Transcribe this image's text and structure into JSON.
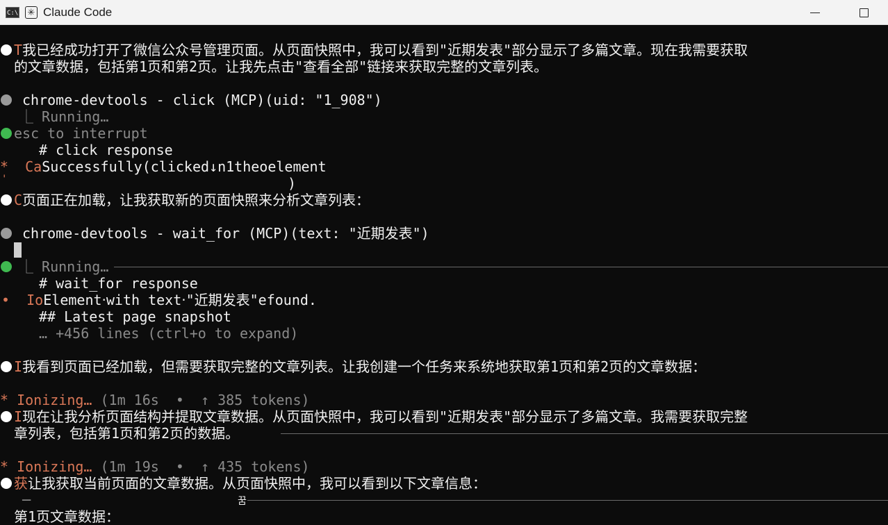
{
  "window": {
    "title": "Claude Code",
    "terminal_icon_text": "C:\\."
  },
  "lines": {
    "l1_prefix": "T",
    "l1": "我已经成功打开了微信公众号管理页面。从页面快照中，我可以看到\"近期发表\"部分显示了多篇文章。现在我需要获取",
    "l2": "的文章数据，包括第1页和第2页。让我先点击\"查看全部\"链接来获取完整的文章列表。",
    "tool1": "chrome-devtools - click (MCP)(uid: \"1_908\")",
    "tool1_running": "⎿ Running…",
    "esc": "esc to interrupt",
    "click_resp": "# click response",
    "spin1_prefix": "*",
    "spin1_a": "Ca",
    "spin1_b": "Successfully(clicked↓n1theoelement",
    "paren_close": ")",
    "apostrophe": "'",
    "l_loading_prefix": "C",
    "l_loading": "页面正在加载，让我获取新的页面快照来分析文章列表：",
    "tool2": "chrome-devtools - wait_for (MCP)(text: \"近期发表\")",
    "tool2_running": "⎿ Running…",
    "wait_resp": "# wait_for response",
    "io_prefix": "•",
    "io_a": "Io",
    "io_b": "Element‧with text‧\"近期发表\"efound.",
    "latest": "## Latest page snapshot",
    "expand": "… +456 lines (ctrl+o to expand)",
    "l_see_prefix": "I",
    "l_see": "我看到页面已经加载，但需要获取完整的文章列表。让我创建一个任务来系统地获取第1页和第2页的文章数据：",
    "ionizing1_star": "*",
    "ionizing1_word": "Ionizing…",
    "ionizing1_meta": "(1m 16s  •  ↑ 385 tokens)",
    "l_now_prefix": "I",
    "l_now": "现在让我分析页面结构并提取文章数据。从页面快照中，我可以看到\"近期发表\"部分显示了多篇文章。我需要获取完整",
    "l_now2": "章列表，包括第1页和第2页的数据。",
    "ionizing2_star": "*",
    "ionizing2_word": "Ionizing…",
    "ionizing2_meta": "(1m 19s  •  ↑ 435 tokens)",
    "l_get_prefix": "获",
    "l_get": "让我获取当前页面的文章数据。从页面快照中，我可以看到以下文章信息：",
    "dash": "─",
    "small_glyph": "꿈",
    "page1": "第1页文章数据："
  }
}
